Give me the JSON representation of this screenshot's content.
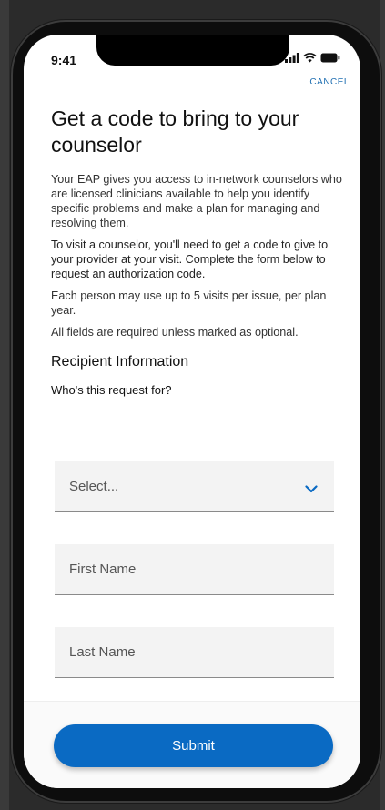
{
  "status_bar": {
    "time": "9:41"
  },
  "header": {
    "cancel_label": "CANCEL"
  },
  "page": {
    "title": "Get a code to bring to your counselor",
    "intro": "Your EAP gives you access to in-network counselors who are licensed clinicians available to help you identify specific problems and make a plan for managing and resolving them.",
    "instructions": "To visit a counselor, you'll need to get a code to give to your provider at your visit. Complete the form below to request an authorization code.",
    "limit_note": "Each person may use up to 5 visits per issue, per plan year.",
    "required_note": "All fields are required unless marked as optional."
  },
  "form": {
    "section_title": "Recipient Information",
    "question": "Who's this request for?",
    "recipient_select": {
      "placeholder": "Select..."
    },
    "first_name": {
      "placeholder": "First Name"
    },
    "last_name": {
      "placeholder": "Last Name"
    }
  },
  "footer": {
    "submit_label": "Submit"
  },
  "colors": {
    "primary": "#0a6ac3",
    "field_bg": "#f3f3f3"
  }
}
